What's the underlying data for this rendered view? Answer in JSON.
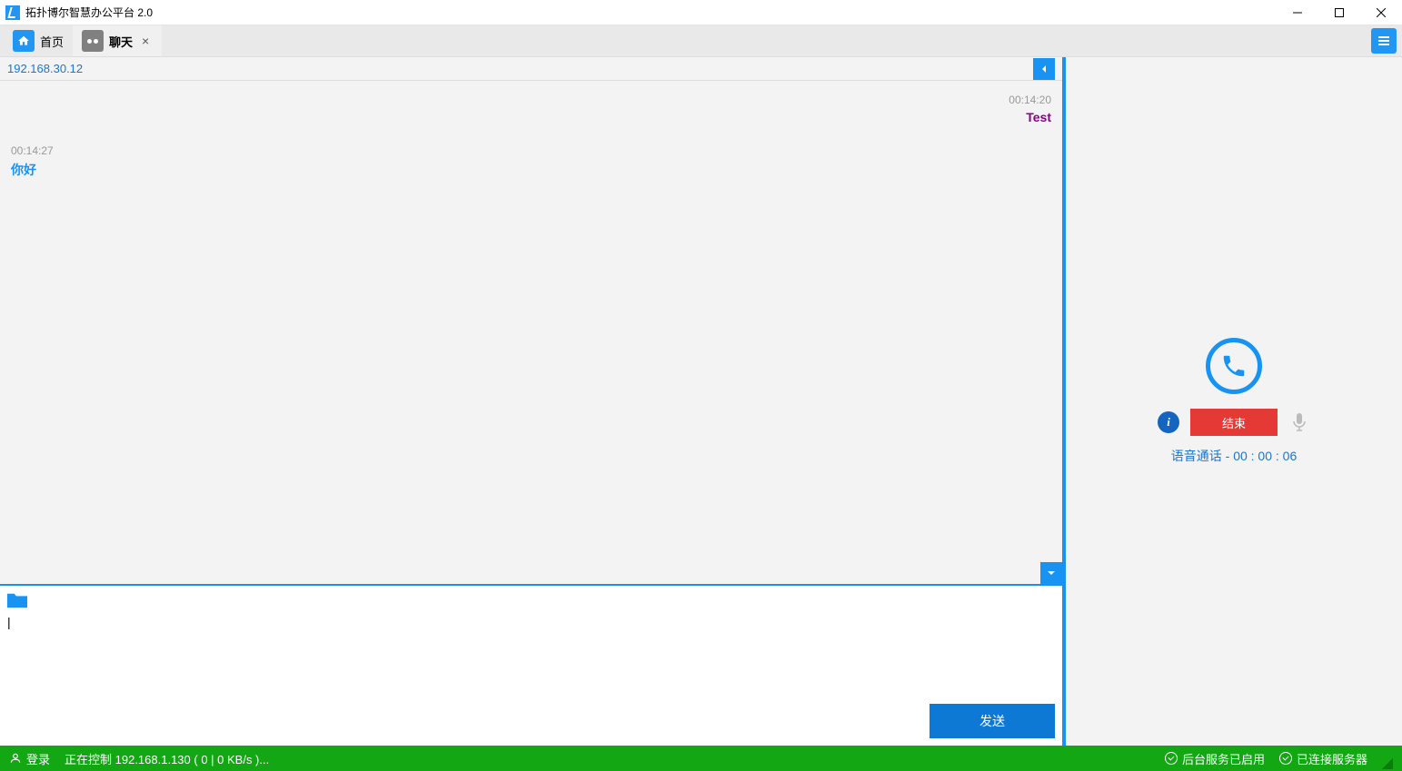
{
  "window": {
    "title": "拓扑博尔智慧办公平台 2.0"
  },
  "tabs": {
    "home_label": "首页",
    "chat_label": "聊天"
  },
  "chat": {
    "peer_ip": "192.168.30.12",
    "messages": [
      {
        "side": "right",
        "time": "00:14:20",
        "text": "Test"
      },
      {
        "side": "left",
        "time": "00:14:27",
        "text": "你好"
      }
    ],
    "send_label": "发送"
  },
  "call": {
    "end_label": "结束",
    "status_prefix": "语音通话 - ",
    "duration": "00 : 00 : 06"
  },
  "status": {
    "login": "登录",
    "controlling": "正在控制 192.168.1.130 ( 0 | 0 KB/s )...",
    "service_started": "后台服务已启用",
    "server_connected": "已连接服务器"
  }
}
